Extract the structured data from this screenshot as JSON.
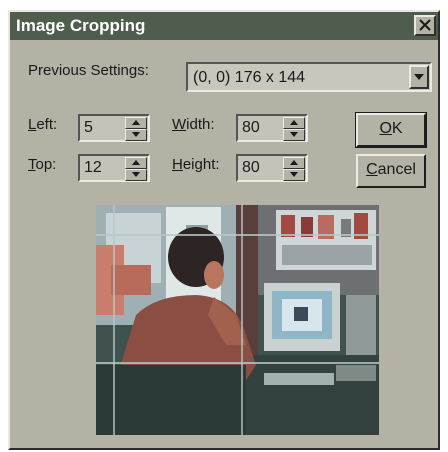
{
  "window": {
    "title": "Image Cropping",
    "close_glyph": "✕"
  },
  "previous_settings": {
    "label": "Previous Settings:",
    "value": "(0, 0) 176 x 144"
  },
  "fields": {
    "left": {
      "label_accel": "L",
      "label_rest": "eft:",
      "value": "5"
    },
    "top": {
      "label_accel": "T",
      "label_rest": "op:",
      "value": "12"
    },
    "width": {
      "label_accel": "W",
      "label_rest": "idth:",
      "value": "80"
    },
    "height": {
      "label_accel": "H",
      "label_rest": "eight:",
      "value": "80"
    }
  },
  "buttons": {
    "ok": {
      "accel": "O",
      "rest": "K"
    },
    "cancel": {
      "accel": "C",
      "rest": "ancel"
    }
  },
  "icons": {
    "close": "close-icon",
    "dropdown": "chevron-down-icon",
    "spin_up": "triangle-up-icon",
    "spin_down": "triangle-down-icon"
  },
  "colors": {
    "titlebar": "#4e5d4e",
    "dialog_face": "#b4b1a5",
    "field_bg": "#c5c3b8",
    "crop_guides": "#b8c9c9"
  }
}
